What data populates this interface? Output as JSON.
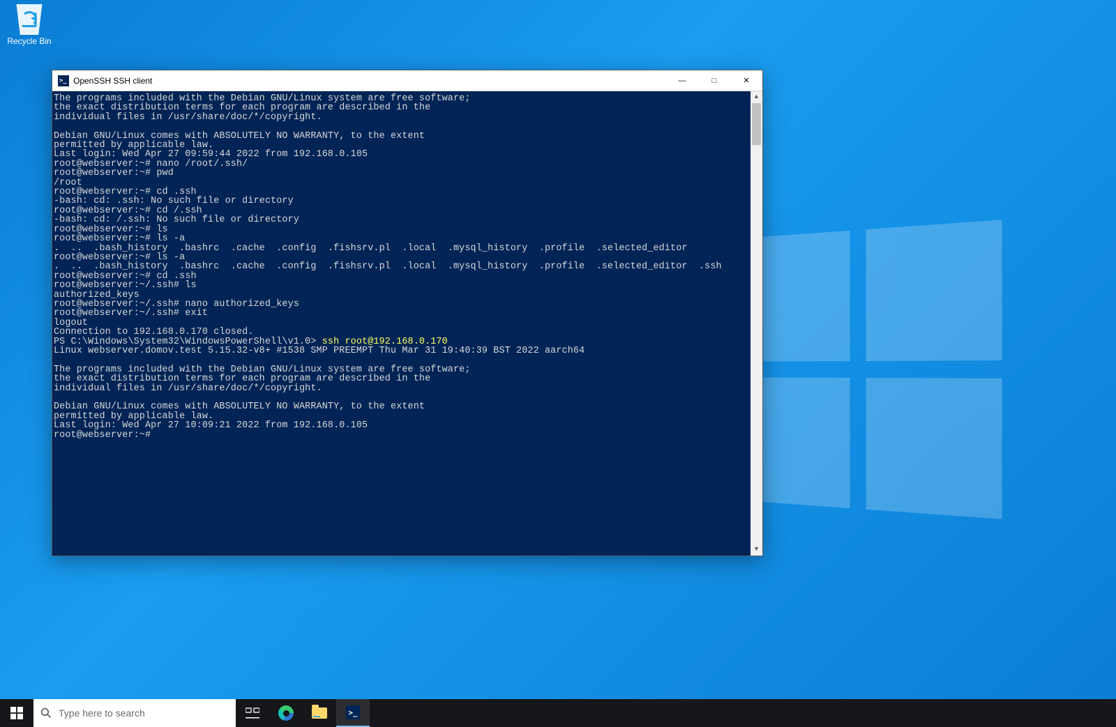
{
  "desktop": {
    "recycle_bin_label": "Recycle Bin"
  },
  "window": {
    "title": "OpenSSH SSH client",
    "controls": {
      "min": "—",
      "max": "□",
      "close": "✕"
    }
  },
  "terminal": {
    "lines": [
      "The programs included with the Debian GNU/Linux system are free software;",
      "the exact distribution terms for each program are described in the",
      "individual files in /usr/share/doc/*/copyright.",
      "",
      "Debian GNU/Linux comes with ABSOLUTELY NO WARRANTY, to the extent",
      "permitted by applicable law.",
      "Last login: Wed Apr 27 09:59:44 2022 from 192.168.0.105",
      "root@webserver:~# nano /root/.ssh/",
      "root@webserver:~# pwd",
      "/root",
      "root@webserver:~# cd .ssh",
      "-bash: cd: .ssh: No such file or directory",
      "root@webserver:~# cd /.ssh",
      "-bash: cd: /.ssh: No such file or directory",
      "root@webserver:~# ls",
      "root@webserver:~# ls -a",
      ".  ..  .bash_history  .bashrc  .cache  .config  .fishsrv.pl  .local  .mysql_history  .profile  .selected_editor",
      "root@webserver:~# ls -a",
      ".  ..  .bash_history  .bashrc  .cache  .config  .fishsrv.pl  .local  .mysql_history  .profile  .selected_editor  .ssh",
      "root@webserver:~# cd .ssh",
      "root@webserver:~/.ssh# ls",
      "authorized_keys",
      "root@webserver:~/.ssh# nano authorized_keys",
      "root@webserver:~/.ssh# exit",
      "logout",
      "Connection to 192.168.0.170 closed."
    ],
    "ps_prompt": "PS C:\\Windows\\System32\\WindowsPowerShell\\v1.0> ",
    "ps_command": "ssh root@192.168.0.170",
    "lines2": [
      "Linux webserver.domov.test 5.15.32-v8+ #1538 SMP PREEMPT Thu Mar 31 19:40:39 BST 2022 aarch64",
      "",
      "The programs included with the Debian GNU/Linux system are free software;",
      "the exact distribution terms for each program are described in the",
      "individual files in /usr/share/doc/*/copyright.",
      "",
      "Debian GNU/Linux comes with ABSOLUTELY NO WARRANTY, to the extent",
      "permitted by applicable law.",
      "Last login: Wed Apr 27 10:09:21 2022 from 192.168.0.105",
      "root@webserver:~#"
    ]
  },
  "taskbar": {
    "search_placeholder": "Type here to search",
    "ps_glyph": ">_"
  }
}
